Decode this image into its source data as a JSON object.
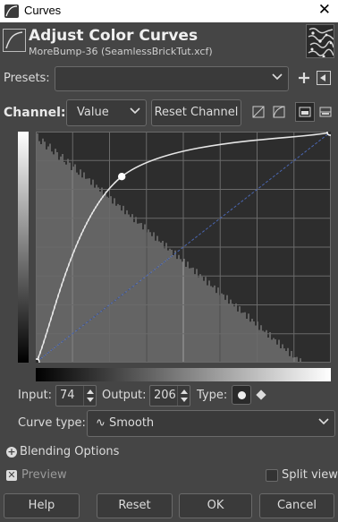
{
  "window": {
    "title": "Curves",
    "close_glyph": "✕"
  },
  "header": {
    "title": "Adjust Color Curves",
    "subtitle": "MoreBump-36 (SeamlessBrickTut.xcf)",
    "icon": "curves-icon",
    "thumbnail": "image-thumbnail"
  },
  "presets": {
    "label": "Presets:",
    "value": "",
    "add_icon": "plus-icon",
    "menu_icon": "menu-arrow-icon"
  },
  "channel": {
    "label": "Channel:",
    "value": "Value",
    "reset_label": "Reset Channel",
    "tools": [
      "linear-histogram-icon",
      "log-histogram-icon",
      "full-view-icon",
      "split-view-icon"
    ]
  },
  "curve": {
    "control_points": [
      [
        0,
        0
      ],
      [
        74,
        206
      ],
      [
        255,
        255
      ]
    ],
    "colors": {
      "curve": "#e6e6e6",
      "diagonal": "#4a66b0",
      "grid": "#6a6a6a",
      "histogram": "#9a9a9a"
    }
  },
  "io": {
    "input_label": "Input:",
    "input_value": "74",
    "output_label": "Output:",
    "output_value": "206",
    "type_label": "Type:",
    "type_icons": [
      "smooth-point-icon",
      "corner-point-icon"
    ]
  },
  "curve_type": {
    "label": "Curve type:",
    "value": "Smooth",
    "icon_glyph": "∿"
  },
  "blending": {
    "label": "Blending Options",
    "glyph": "+"
  },
  "preview": {
    "label": "Preview",
    "checked": true,
    "glyph": "✕"
  },
  "split_view": {
    "label": "Split view",
    "checked": false
  },
  "buttons": {
    "help": "Help",
    "reset": "Reset",
    "ok": "OK",
    "cancel": "Cancel"
  }
}
